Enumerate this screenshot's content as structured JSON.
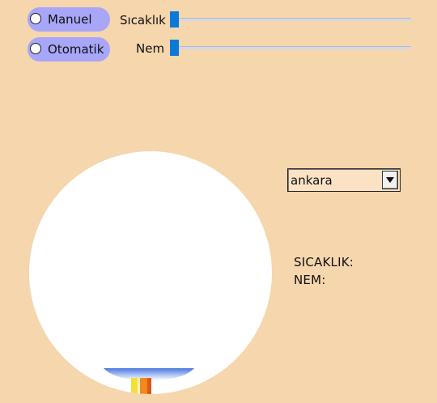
{
  "mode": {
    "manual_label": "Manuel",
    "auto_label": "Otomatik"
  },
  "sliders": {
    "temperature_label": "Sıcaklık",
    "temperature_value": 0,
    "humidity_label": "Nem",
    "humidity_value": 0
  },
  "city": {
    "selected": "ankara"
  },
  "readouts": {
    "temperature_label": "SICAKLIK:",
    "humidity_label": "NEM:"
  },
  "colors": {
    "background": "#f5d6ad",
    "pill": "#a7a6f8",
    "slider_thumb": "#0a7ad9",
    "circle": "#ffffff"
  },
  "icons": {
    "dropdown": "chevron-down-icon"
  }
}
